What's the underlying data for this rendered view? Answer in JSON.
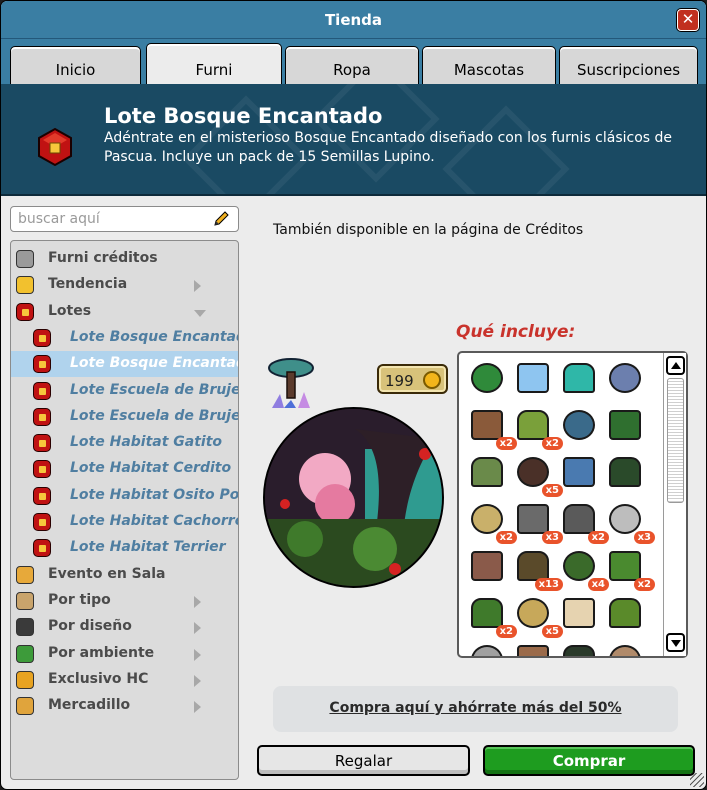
{
  "window": {
    "title": "Tienda",
    "close_label": "✕"
  },
  "tabs": [
    {
      "label": "Inicio"
    },
    {
      "label": "Furni"
    },
    {
      "label": "Ropa"
    },
    {
      "label": "Mascotas"
    },
    {
      "label": "Suscripciones"
    }
  ],
  "banner": {
    "title": "Lote Bosque Encantado",
    "description": "Adéntrate en el misterioso Bosque Encantado diseñado con los furnis clásicos de Pascua. Incluye un pack de 15 Semillas Lupino."
  },
  "search": {
    "placeholder": "buscar aquí"
  },
  "categories": [
    {
      "label": "Furni créditos",
      "icon": "coins-stack-icon",
      "arrow": "none",
      "sub": false
    },
    {
      "label": "Tendencia",
      "icon": "star-icon",
      "arrow": "right",
      "sub": false
    },
    {
      "label": "Lotes",
      "icon": "bundle-box-icon",
      "arrow": "down",
      "sub": false
    },
    {
      "label": "Lote Bosque Encantado",
      "icon": "bundle-box-icon",
      "arrow": "none",
      "sub": true
    },
    {
      "label": "Lote Bosque Encantado",
      "icon": "bundle-box-icon",
      "arrow": "none",
      "sub": true,
      "selected": true
    },
    {
      "label": "Lote Escuela de Brujería",
      "icon": "bundle-box-icon",
      "arrow": "none",
      "sub": true
    },
    {
      "label": "Lote Escuela de Brujería",
      "icon": "bundle-box-icon",
      "arrow": "none",
      "sub": true
    },
    {
      "label": "Lote Habitat Gatito",
      "icon": "bundle-box-icon",
      "arrow": "none",
      "sub": true
    },
    {
      "label": "Lote Habitat Cerdito",
      "icon": "bundle-box-icon",
      "arrow": "none",
      "sub": true
    },
    {
      "label": "Lote Habitat Osito Polar",
      "icon": "bundle-box-icon",
      "arrow": "none",
      "sub": true
    },
    {
      "label": "Lote Habitat Cachorro",
      "icon": "bundle-box-icon",
      "arrow": "none",
      "sub": true
    },
    {
      "label": "Lote Habitat Terrier",
      "icon": "bundle-box-icon",
      "arrow": "none",
      "sub": true
    },
    {
      "label": "Evento en Sala",
      "icon": "event-icon",
      "arrow": "none",
      "sub": false
    },
    {
      "label": "Por tipo",
      "icon": "furniture-type-icon",
      "arrow": "right",
      "sub": false
    },
    {
      "label": "Por diseño",
      "icon": "columns-building-icon",
      "arrow": "right",
      "sub": false
    },
    {
      "label": "Por ambiente",
      "icon": "plant-icon",
      "arrow": "right",
      "sub": false
    },
    {
      "label": "Exclusivo HC",
      "icon": "hc-badge-icon",
      "arrow": "right",
      "sub": false
    },
    {
      "label": "Mercadillo",
      "icon": "marketplace-icon",
      "arrow": "right",
      "sub": false
    }
  ],
  "product": {
    "availability_note": "También disponible en la página de Créditos",
    "price": "199",
    "includes_title": "Qué incluye:"
  },
  "included_items": [
    {
      "icon": "palm-tree-icon",
      "count": ""
    },
    {
      "icon": "butterflies-icon",
      "count": ""
    },
    {
      "icon": "teal-floor-tile-icon",
      "count": ""
    },
    {
      "icon": "rug-icon",
      "count": ""
    },
    {
      "icon": "mushroom-table-icon",
      "count": "x2"
    },
    {
      "icon": "grass-tile-icon",
      "count": "x2"
    },
    {
      "icon": "lantern-plant-icon",
      "count": ""
    },
    {
      "icon": "pine-tree-icon",
      "count": ""
    },
    {
      "icon": "sprout-icon",
      "count": ""
    },
    {
      "icon": "dark-rock-icon",
      "count": "x5"
    },
    {
      "icon": "poster-icon",
      "count": ""
    },
    {
      "icon": "cactus-icon",
      "count": ""
    },
    {
      "icon": "sand-tile-icon",
      "count": "x2"
    },
    {
      "icon": "horseshoe-arch-icon",
      "count": "x3"
    },
    {
      "icon": "deck-chair-icon",
      "count": "x2"
    },
    {
      "icon": "spider-web-icon",
      "count": "x3"
    },
    {
      "icon": "beetle-chair-icon",
      "count": ""
    },
    {
      "icon": "dirt-tile-icon",
      "count": "x13"
    },
    {
      "icon": "moss-tile-icon",
      "count": "x4"
    },
    {
      "icon": "bush-icon",
      "count": "x2"
    },
    {
      "icon": "hedge-icon",
      "count": "x2"
    },
    {
      "icon": "hay-tile-icon",
      "count": "x5"
    },
    {
      "icon": "mushroom-cluster-icon",
      "count": ""
    },
    {
      "icon": "round-tree-icon",
      "count": ""
    },
    {
      "icon": "grey-rock-icon",
      "count": ""
    },
    {
      "icon": "stump-icon",
      "count": ""
    },
    {
      "icon": "dark-bush-icon",
      "count": ""
    },
    {
      "icon": "post-icon",
      "count": ""
    }
  ],
  "promo": {
    "link_label": "Compra aquí y ahórrate más del 50%"
  },
  "actions": {
    "gift_label": "Regalar",
    "buy_label": "Comprar"
  },
  "colors": {
    "titlebar": "#3a7ea3",
    "banner": "#1a4a63",
    "buy": "#1e9c1f",
    "includes": "#c9332c",
    "selection": "#b0d3ed"
  }
}
